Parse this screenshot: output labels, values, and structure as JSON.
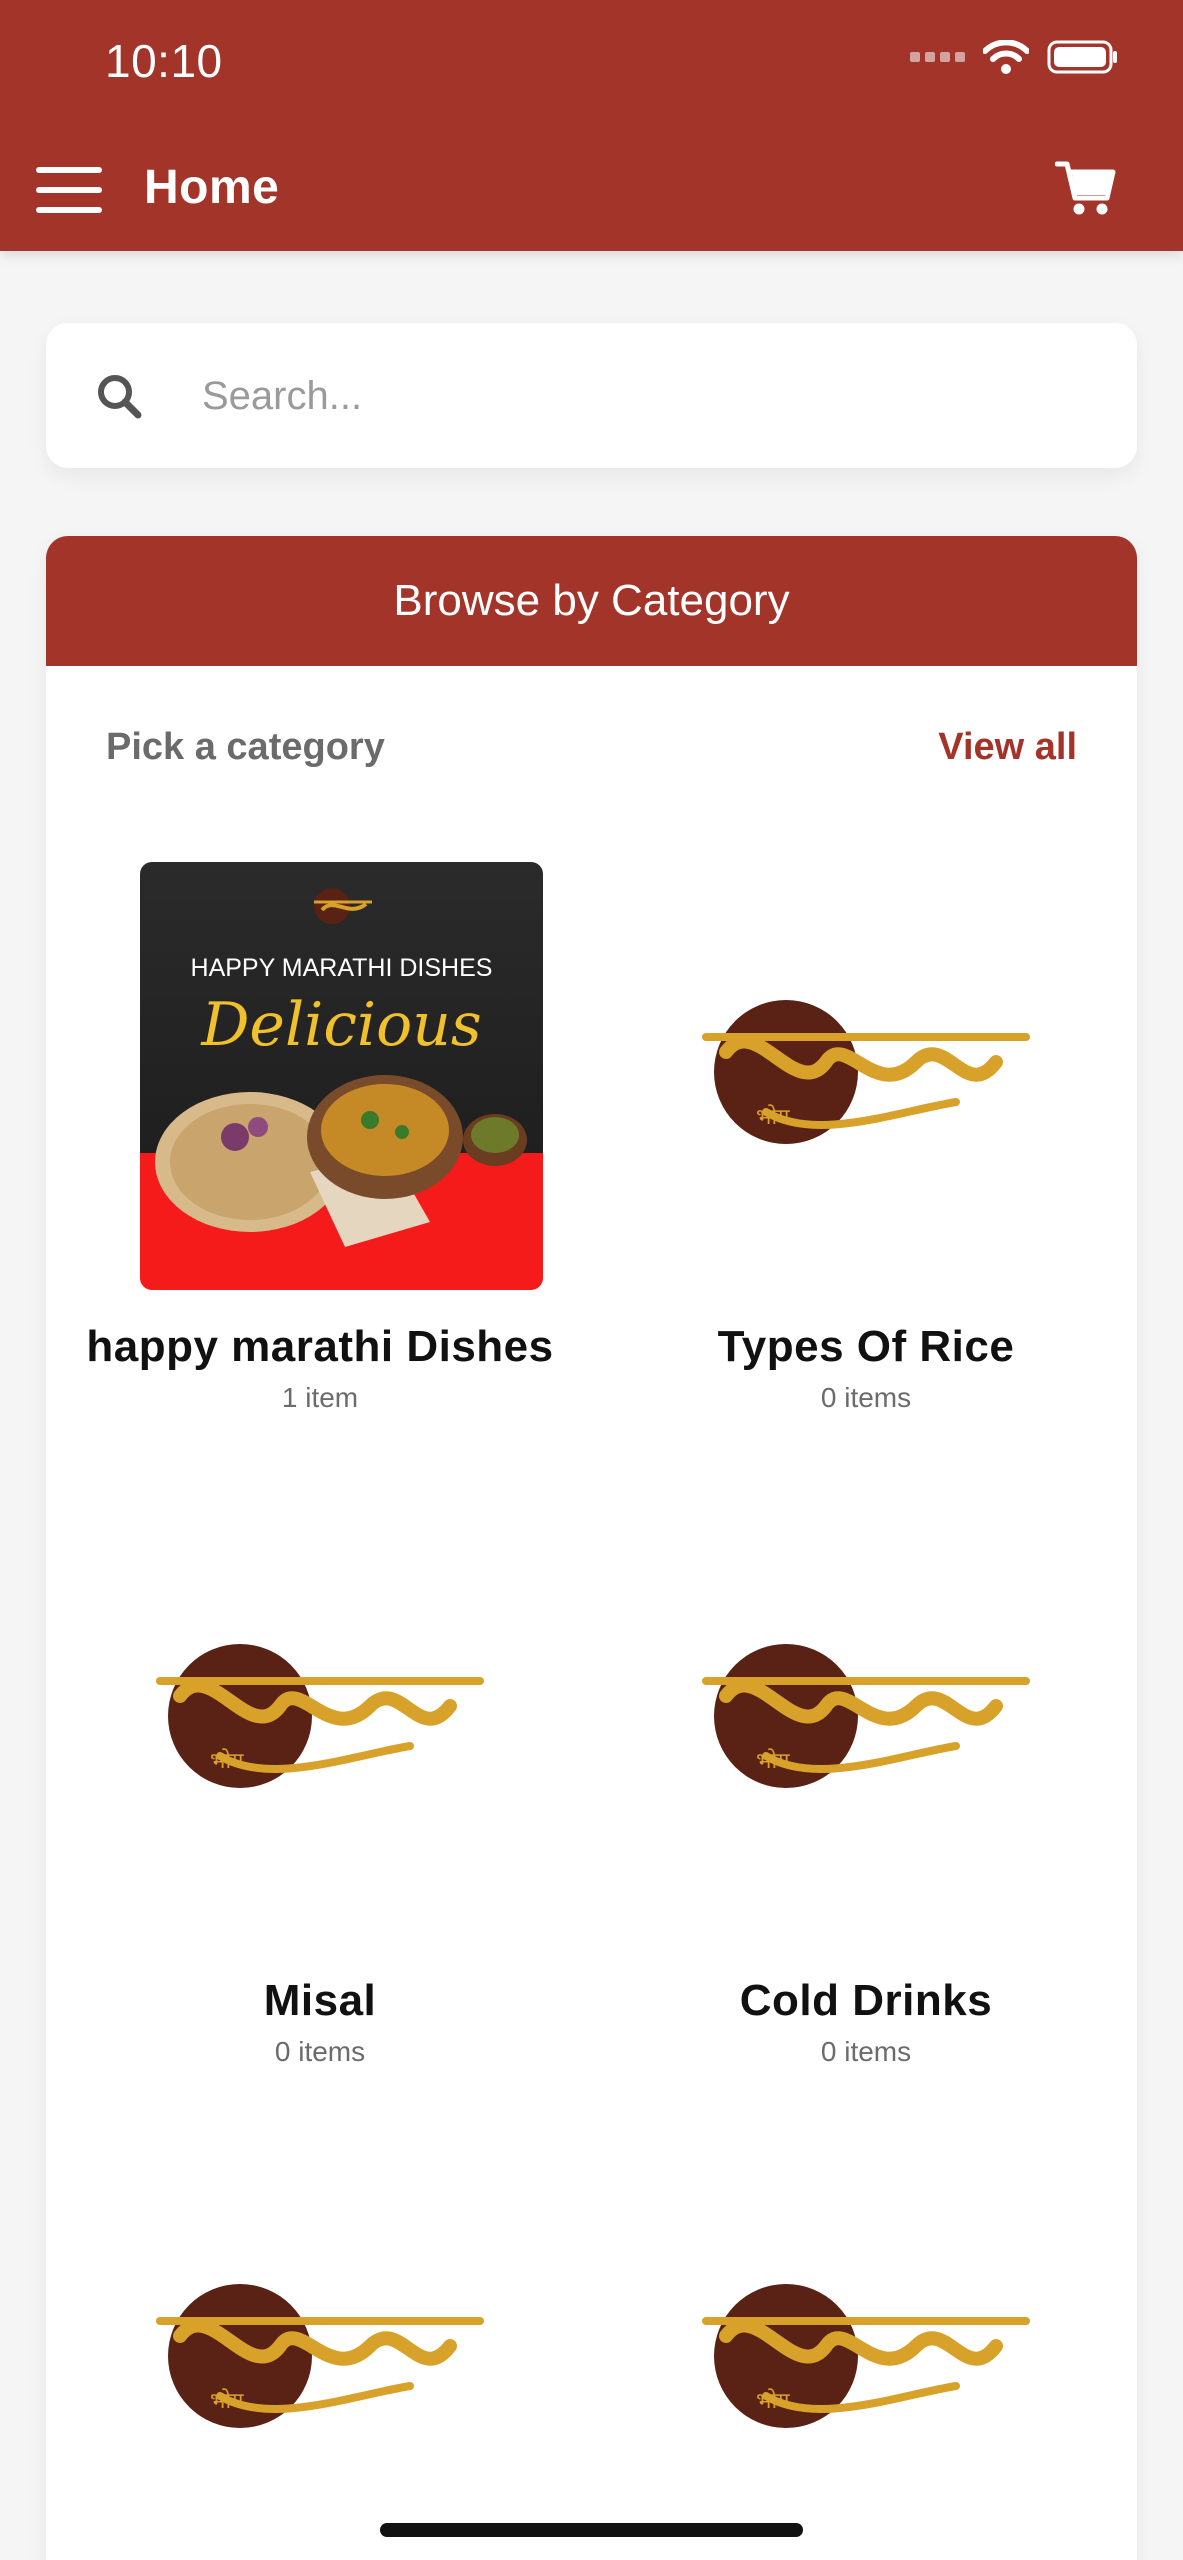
{
  "status_bar": {
    "time": "10:10"
  },
  "header": {
    "title": "Home"
  },
  "search": {
    "placeholder": "Search..."
  },
  "categories_section": {
    "title": "Browse by Category",
    "subtitle": "Pick a category",
    "view_all": "View all",
    "items": [
      {
        "name": "happy marathi Dishes",
        "count": "1 item",
        "image": "promo"
      },
      {
        "name": "Types Of Rice",
        "count": "0 items",
        "image": "logo"
      },
      {
        "name": "Misal",
        "count": "0 items",
        "image": "logo"
      },
      {
        "name": "Cold Drinks",
        "count": "0 items",
        "image": "logo"
      },
      {
        "name": "",
        "count": "",
        "image": "logo"
      },
      {
        "name": "",
        "count": "",
        "image": "logo"
      }
    ],
    "promo_image": {
      "caption": "HAPPY MARATHI DISHES",
      "script": "Delicious"
    }
  },
  "logo": {
    "text": "राजेशाही",
    "subtext": "भोग"
  },
  "colors": {
    "brand": "#a3342a",
    "logo_gold": "#d8a12a",
    "logo_brown": "#5a2115"
  }
}
